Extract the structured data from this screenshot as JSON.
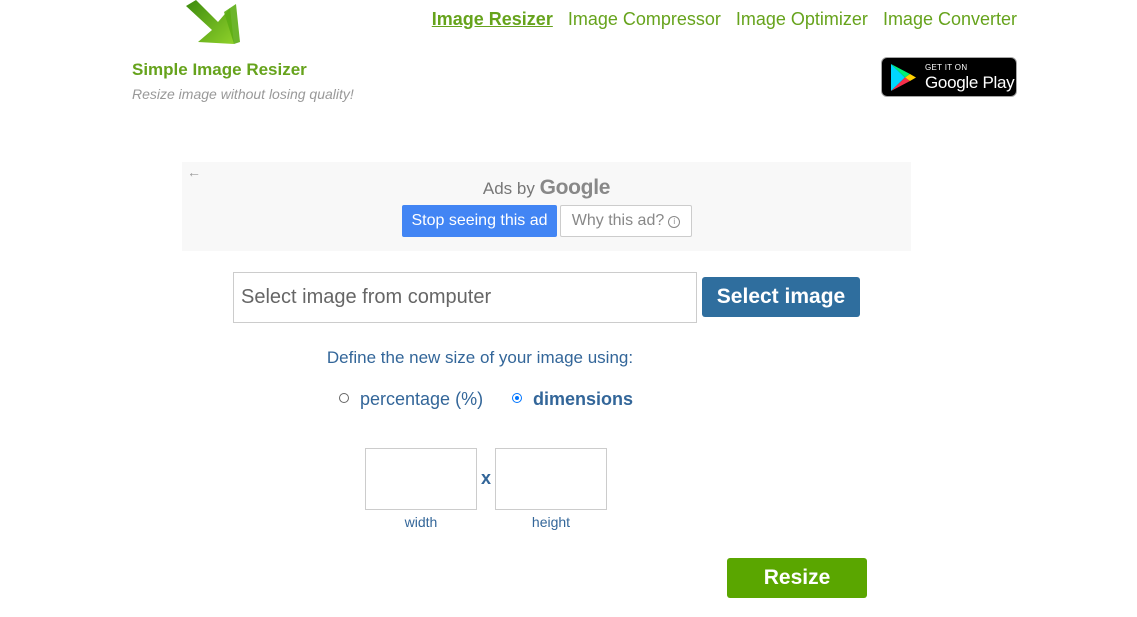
{
  "header": {
    "logo_icon": "green-down-arrow-icon",
    "title": "Simple Image Resizer",
    "tagline": "Resize image without losing quality!",
    "nav": [
      {
        "label": "Image Resizer",
        "active": true
      },
      {
        "label": "Image Compressor",
        "active": false
      },
      {
        "label": "Image Optimizer",
        "active": false
      },
      {
        "label": "Image Converter",
        "active": false
      }
    ],
    "play_badge": {
      "small": "GET IT ON",
      "big": "Google Play"
    }
  },
  "ad": {
    "ads_by": "Ads by",
    "google": "Google",
    "stop_label": "Stop seeing this ad",
    "why_label": "Why this ad?",
    "back_icon": "back-arrow-icon",
    "info_icon": "info-icon"
  },
  "upload": {
    "placeholder": "Select image from computer",
    "button_label": "Select image"
  },
  "resize_options": {
    "prompt": "Define the new size of your image using:",
    "percentage_label": "percentage (%)",
    "dimensions_label": "dimensions",
    "selected": "dimensions",
    "separator": "x",
    "width_label": "width",
    "height_label": "height",
    "width_value": "",
    "height_value": ""
  },
  "resize_button": "Resize",
  "colors": {
    "brand_green": "#66a31c",
    "blue_text": "#336699",
    "select_button": "#2f6e9e",
    "resize_button": "#5aa600",
    "ad_button": "#4285f4"
  }
}
